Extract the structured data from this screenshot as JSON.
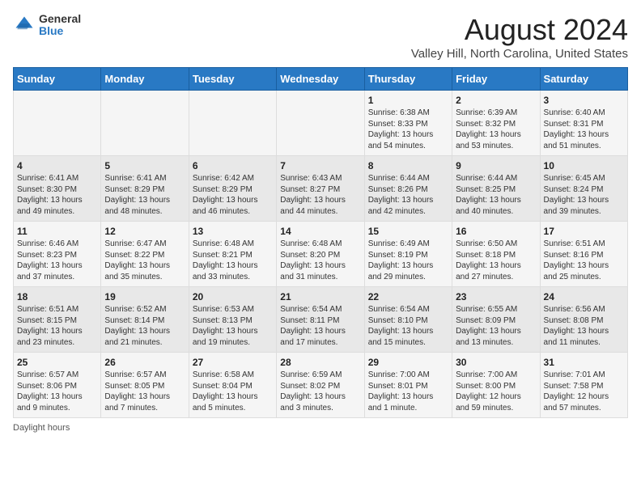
{
  "logo": {
    "general": "General",
    "blue": "Blue"
  },
  "title": "August 2024",
  "subtitle": "Valley Hill, North Carolina, United States",
  "days_of_week": [
    "Sunday",
    "Monday",
    "Tuesday",
    "Wednesday",
    "Thursday",
    "Friday",
    "Saturday"
  ],
  "weeks": [
    [
      {
        "day": "",
        "info": ""
      },
      {
        "day": "",
        "info": ""
      },
      {
        "day": "",
        "info": ""
      },
      {
        "day": "",
        "info": ""
      },
      {
        "day": "1",
        "info": "Sunrise: 6:38 AM\nSunset: 8:33 PM\nDaylight: 13 hours and 54 minutes."
      },
      {
        "day": "2",
        "info": "Sunrise: 6:39 AM\nSunset: 8:32 PM\nDaylight: 13 hours and 53 minutes."
      },
      {
        "day": "3",
        "info": "Sunrise: 6:40 AM\nSunset: 8:31 PM\nDaylight: 13 hours and 51 minutes."
      }
    ],
    [
      {
        "day": "4",
        "info": "Sunrise: 6:41 AM\nSunset: 8:30 PM\nDaylight: 13 hours and 49 minutes."
      },
      {
        "day": "5",
        "info": "Sunrise: 6:41 AM\nSunset: 8:29 PM\nDaylight: 13 hours and 48 minutes."
      },
      {
        "day": "6",
        "info": "Sunrise: 6:42 AM\nSunset: 8:29 PM\nDaylight: 13 hours and 46 minutes."
      },
      {
        "day": "7",
        "info": "Sunrise: 6:43 AM\nSunset: 8:27 PM\nDaylight: 13 hours and 44 minutes."
      },
      {
        "day": "8",
        "info": "Sunrise: 6:44 AM\nSunset: 8:26 PM\nDaylight: 13 hours and 42 minutes."
      },
      {
        "day": "9",
        "info": "Sunrise: 6:44 AM\nSunset: 8:25 PM\nDaylight: 13 hours and 40 minutes."
      },
      {
        "day": "10",
        "info": "Sunrise: 6:45 AM\nSunset: 8:24 PM\nDaylight: 13 hours and 39 minutes."
      }
    ],
    [
      {
        "day": "11",
        "info": "Sunrise: 6:46 AM\nSunset: 8:23 PM\nDaylight: 13 hours and 37 minutes."
      },
      {
        "day": "12",
        "info": "Sunrise: 6:47 AM\nSunset: 8:22 PM\nDaylight: 13 hours and 35 minutes."
      },
      {
        "day": "13",
        "info": "Sunrise: 6:48 AM\nSunset: 8:21 PM\nDaylight: 13 hours and 33 minutes."
      },
      {
        "day": "14",
        "info": "Sunrise: 6:48 AM\nSunset: 8:20 PM\nDaylight: 13 hours and 31 minutes."
      },
      {
        "day": "15",
        "info": "Sunrise: 6:49 AM\nSunset: 8:19 PM\nDaylight: 13 hours and 29 minutes."
      },
      {
        "day": "16",
        "info": "Sunrise: 6:50 AM\nSunset: 8:18 PM\nDaylight: 13 hours and 27 minutes."
      },
      {
        "day": "17",
        "info": "Sunrise: 6:51 AM\nSunset: 8:16 PM\nDaylight: 13 hours and 25 minutes."
      }
    ],
    [
      {
        "day": "18",
        "info": "Sunrise: 6:51 AM\nSunset: 8:15 PM\nDaylight: 13 hours and 23 minutes."
      },
      {
        "day": "19",
        "info": "Sunrise: 6:52 AM\nSunset: 8:14 PM\nDaylight: 13 hours and 21 minutes."
      },
      {
        "day": "20",
        "info": "Sunrise: 6:53 AM\nSunset: 8:13 PM\nDaylight: 13 hours and 19 minutes."
      },
      {
        "day": "21",
        "info": "Sunrise: 6:54 AM\nSunset: 8:11 PM\nDaylight: 13 hours and 17 minutes."
      },
      {
        "day": "22",
        "info": "Sunrise: 6:54 AM\nSunset: 8:10 PM\nDaylight: 13 hours and 15 minutes."
      },
      {
        "day": "23",
        "info": "Sunrise: 6:55 AM\nSunset: 8:09 PM\nDaylight: 13 hours and 13 minutes."
      },
      {
        "day": "24",
        "info": "Sunrise: 6:56 AM\nSunset: 8:08 PM\nDaylight: 13 hours and 11 minutes."
      }
    ],
    [
      {
        "day": "25",
        "info": "Sunrise: 6:57 AM\nSunset: 8:06 PM\nDaylight: 13 hours and 9 minutes."
      },
      {
        "day": "26",
        "info": "Sunrise: 6:57 AM\nSunset: 8:05 PM\nDaylight: 13 hours and 7 minutes."
      },
      {
        "day": "27",
        "info": "Sunrise: 6:58 AM\nSunset: 8:04 PM\nDaylight: 13 hours and 5 minutes."
      },
      {
        "day": "28",
        "info": "Sunrise: 6:59 AM\nSunset: 8:02 PM\nDaylight: 13 hours and 3 minutes."
      },
      {
        "day": "29",
        "info": "Sunrise: 7:00 AM\nSunset: 8:01 PM\nDaylight: 13 hours and 1 minute."
      },
      {
        "day": "30",
        "info": "Sunrise: 7:00 AM\nSunset: 8:00 PM\nDaylight: 12 hours and 59 minutes."
      },
      {
        "day": "31",
        "info": "Sunrise: 7:01 AM\nSunset: 7:58 PM\nDaylight: 12 hours and 57 minutes."
      }
    ]
  ],
  "footer": {
    "daylight_hours_label": "Daylight hours"
  }
}
